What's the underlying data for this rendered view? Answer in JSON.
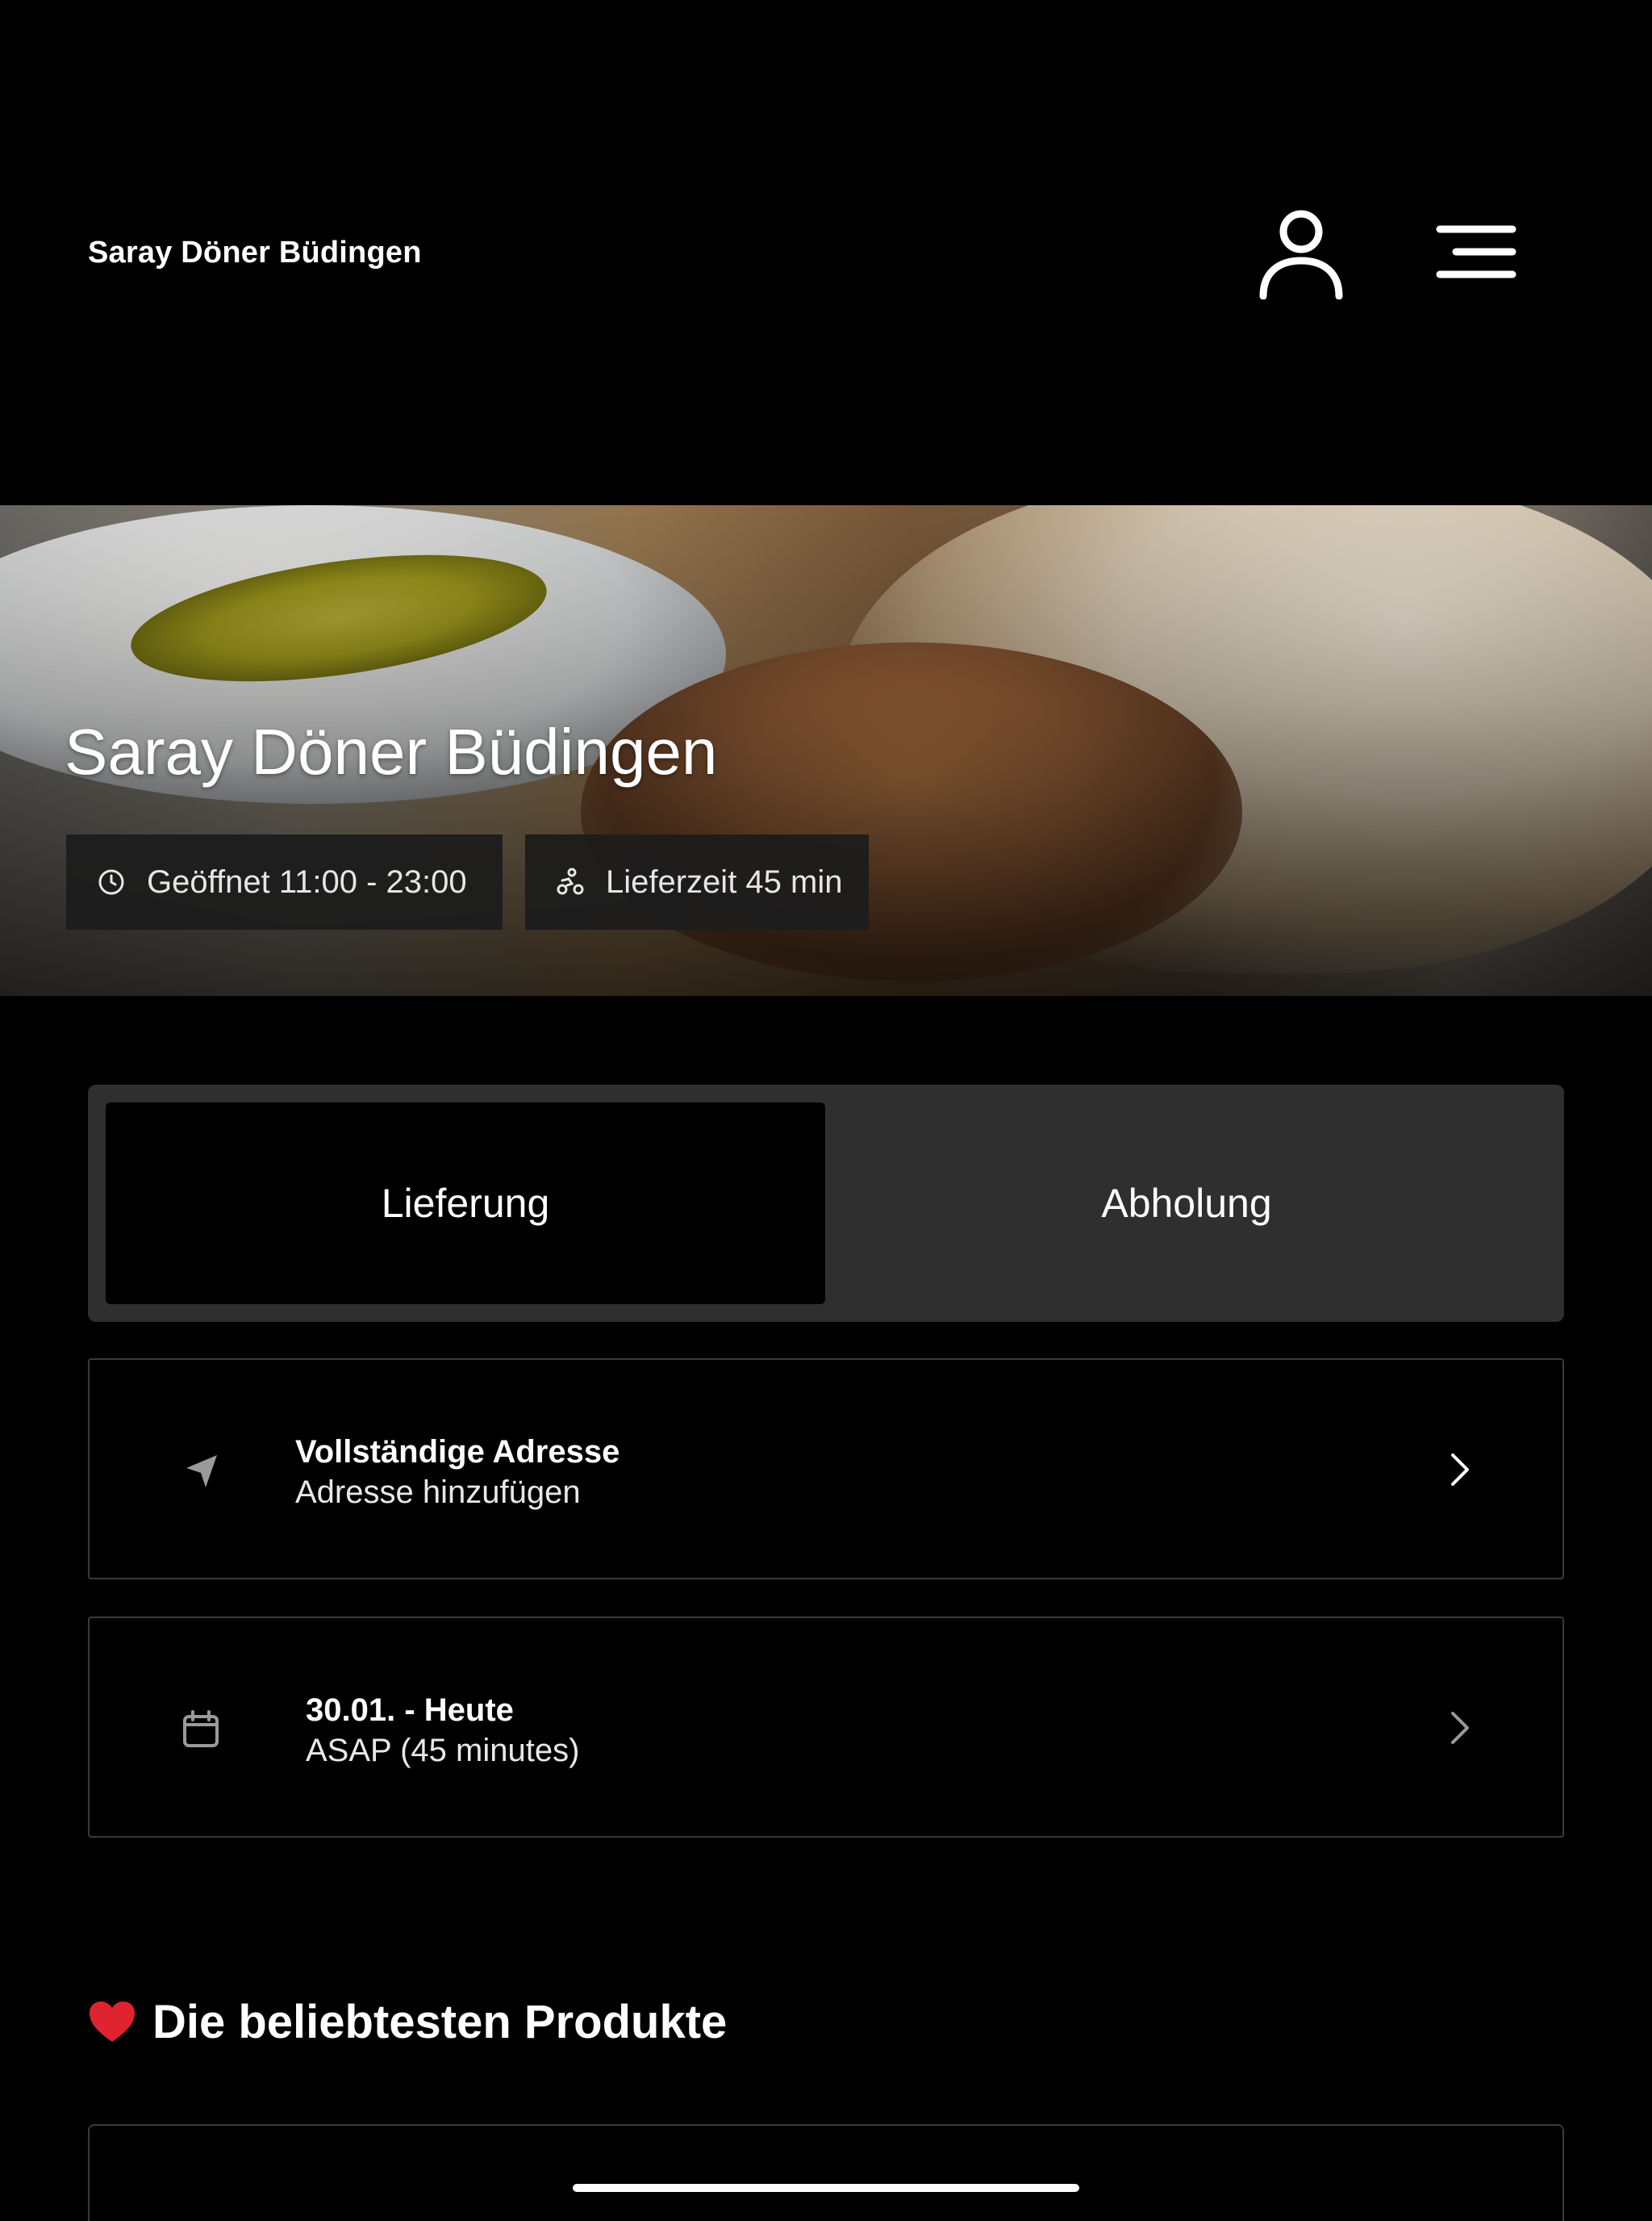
{
  "header": {
    "brand": "Saray Döner Büdingen",
    "user_icon": "user-icon",
    "menu_icon": "menu-icon"
  },
  "hero": {
    "title": "Saray Döner Büdingen",
    "hours_icon": "clock-icon",
    "hours_label": "Geöffnet 11:00 - 23:00",
    "delivery_icon": "scooter-icon",
    "delivery_label": "Lieferzeit 45 min"
  },
  "order_mode": {
    "options": [
      "Lieferung",
      "Abholung"
    ],
    "selected": "Lieferung"
  },
  "address_card": {
    "icon": "location-arrow-icon",
    "title": "Vollständige Adresse",
    "subtitle": "Adresse hinzufügen"
  },
  "time_card": {
    "icon": "calendar-icon",
    "title": "30.01. - Heute",
    "subtitle": "ASAP (45 minutes)"
  },
  "popular": {
    "icon": "heart-icon",
    "title": "Die beliebtesten Produkte"
  },
  "colors": {
    "background": "#000000",
    "segment_bg": "#2f2f2f",
    "heart": "#e0242f"
  }
}
